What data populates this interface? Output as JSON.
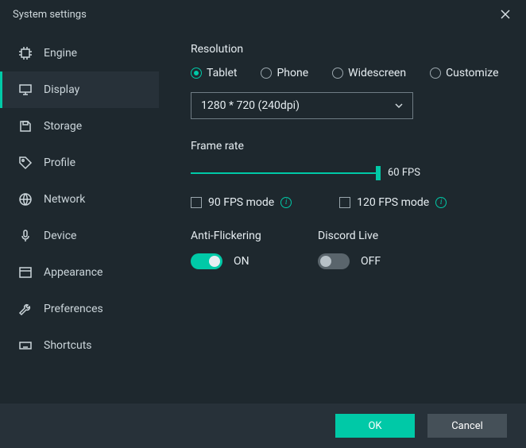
{
  "window": {
    "title": "System settings"
  },
  "sidebar": {
    "items": [
      {
        "label": "Engine"
      },
      {
        "label": "Display"
      },
      {
        "label": "Storage"
      },
      {
        "label": "Profile"
      },
      {
        "label": "Network"
      },
      {
        "label": "Device"
      },
      {
        "label": "Appearance"
      },
      {
        "label": "Preferences"
      },
      {
        "label": "Shortcuts"
      }
    ]
  },
  "resolution": {
    "heading": "Resolution",
    "options": {
      "tablet": "Tablet",
      "phone": "Phone",
      "widescreen": "Widescreen",
      "customize": "Customize"
    },
    "dropdown_value": "1280 * 720 (240dpi)"
  },
  "framerate": {
    "heading": "Frame rate",
    "value_label": "60 FPS",
    "check90": "90 FPS mode",
    "check120": "120 FPS mode"
  },
  "antiflicker": {
    "heading": "Anti-Flickering",
    "state": "ON"
  },
  "discord": {
    "heading": "Discord Live",
    "state": "OFF"
  },
  "footer": {
    "ok": "OK",
    "cancel": "Cancel"
  }
}
